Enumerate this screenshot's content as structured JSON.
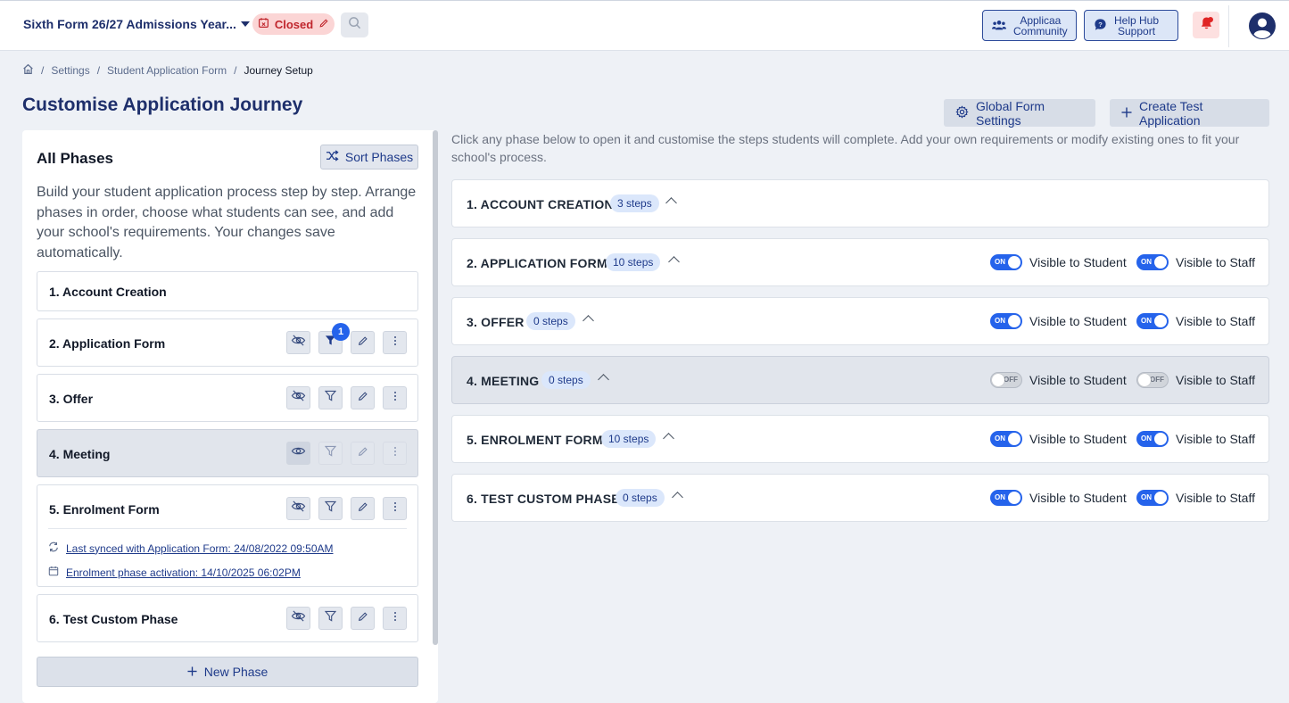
{
  "header": {
    "year_selector": "Sixth Form 26/27 Admissions Year...",
    "status_badge": "Closed",
    "community_line1": "Applicaa",
    "community_line2": "Community",
    "help_line1": "Help Hub",
    "help_line2": "Support"
  },
  "breadcrumb": {
    "sep": "/",
    "items": [
      "Settings",
      "Student Application Form"
    ],
    "current": "Journey Setup"
  },
  "page": {
    "title": "Customise Application Journey",
    "global_settings_label": "Global Form Settings",
    "create_test_label": "Create Test Application"
  },
  "left_panel": {
    "title": "All Phases",
    "sort_label": "Sort Phases",
    "description": "Build your student application process step by step. Arrange phases in order, choose what students can see, and add your school's requirements. Your changes save automatically.",
    "phases": [
      {
        "name": "1. Account Creation"
      },
      {
        "name": "2. Application Form",
        "filter_count": "1"
      },
      {
        "name": "3. Offer"
      },
      {
        "name": "4. Meeting"
      },
      {
        "name": "5. Enrolment Form",
        "sync_text": "Last synced with Application Form: 24/08/2022 09:50AM",
        "activation_text": "Enrolment phase activation: 14/10/2025 06:02PM"
      },
      {
        "name": "6. Test Custom Phase"
      }
    ],
    "new_phase_label": "New Phase"
  },
  "right_panel": {
    "description": "Click any phase below to open it and customise the steps students will complete. Add your own requirements or modify existing ones to fit your school's process.",
    "visible_student_label": "Visible to Student",
    "visible_staff_label": "Visible to Staff",
    "toggle_on": "ON",
    "toggle_off": "OFF",
    "phases": [
      {
        "name": "1. ACCOUNT CREATION",
        "steps": "3 steps"
      },
      {
        "name": "2. APPLICATION FORM",
        "steps": "10 steps",
        "student_visible": true,
        "staff_visible": true
      },
      {
        "name": "3. OFFER",
        "steps": "0 steps",
        "student_visible": true,
        "staff_visible": true
      },
      {
        "name": "4. MEETING",
        "steps": "0 steps",
        "student_visible": false,
        "staff_visible": false
      },
      {
        "name": "5. ENROLMENT FORM",
        "steps": "10 steps",
        "student_visible": true,
        "staff_visible": true
      },
      {
        "name": "6. TEST CUSTOM PHASE",
        "steps": "0 steps",
        "student_visible": true,
        "staff_visible": true
      }
    ]
  },
  "colors": {
    "brand": "#1e2f6b",
    "accent": "#2563eb",
    "closed": "#c0262d"
  }
}
